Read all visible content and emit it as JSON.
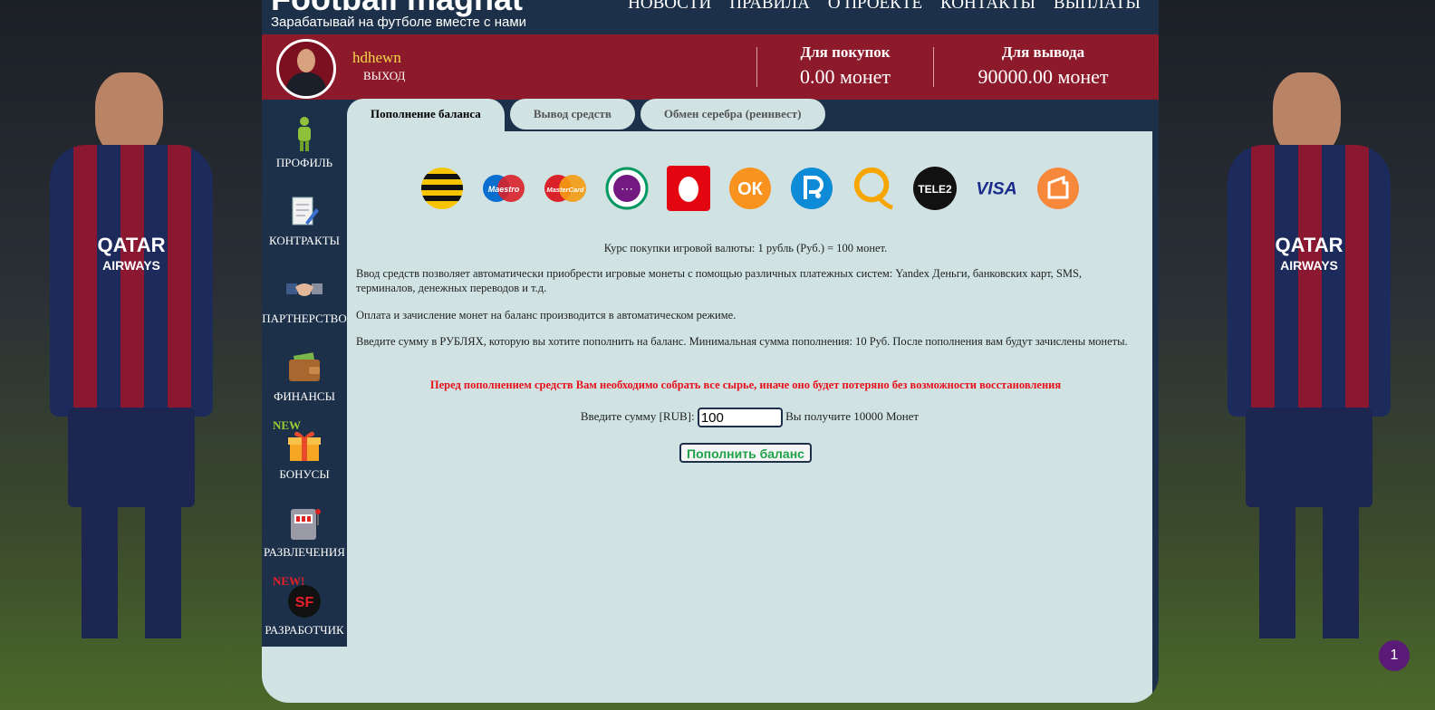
{
  "header": {
    "logo": "Football magnat",
    "tagline": "Зарабатывай на футболе вместе с нами",
    "nav": [
      "НОВОСТИ",
      "ПРАВИЛА",
      "О ПРОЕКТЕ",
      "КОНТАКТЫ",
      "ВЫПЛАТЫ"
    ]
  },
  "user": {
    "name": "hdhewn",
    "logout": "ВЫХОД"
  },
  "balances": {
    "buy": {
      "title": "Для покупок",
      "value": "0.00 монет"
    },
    "withdraw": {
      "title": "Для вывода",
      "value": "90000.00 монет"
    }
  },
  "sidebar": {
    "items": [
      {
        "label": "ПРОФИЛЬ",
        "icon": "person-icon"
      },
      {
        "label": "КОНТРАКТЫ",
        "icon": "document-icon"
      },
      {
        "label": "ПАРТНЕРСТВО",
        "icon": "handshake-icon"
      },
      {
        "label": "ФИНАНСЫ",
        "icon": "wallet-icon"
      },
      {
        "label": "БОНУСЫ",
        "icon": "gift-icon",
        "badge": "NEW"
      },
      {
        "label": "РАЗВЛЕЧЕНИЯ",
        "icon": "slot-machine-icon"
      },
      {
        "label": "РАЗРАБОТЧИК",
        "icon": "developer-logo-icon",
        "badge": "NEW!"
      }
    ]
  },
  "tabs": [
    "Пополнение баланса",
    "Вывод средств",
    "Обмен серебра (реинвест)"
  ],
  "payment_methods": [
    "Beeline",
    "Maestro",
    "MasterCard",
    "Megafon",
    "MTS",
    "Odnoklassniki",
    "Payeer",
    "QIWI",
    "Tele2",
    "VISA",
    "Yandex Money"
  ],
  "payment_labels": {
    "maestro": "Maestro",
    "mastercard": "MasterCard",
    "tele2": "TELE2",
    "visa": "VISA",
    "ok": "ОК",
    "sf": "SF"
  },
  "content": {
    "rate": "Курс покупки игровой валюты: 1 рубль (Руб.) = 100 монет.",
    "p1": "Ввод средств позволяет автоматически приобрести игровые монеты с помощью различных платежных систем: Yandex Деньги, банковских карт, SMS, терминалов, денежных переводов и т.д.",
    "p2": "Оплата и зачисление монет на баланс производится в автоматическом режиме.",
    "p3": "Введите сумму в РУБЛЯХ, которую вы хотите пополнить на баланс. Минимальная сумма пополнения: 10 Руб. После пополнения вам будут зачислены монеты.",
    "warning": "Перед пополнением средств Вам необходимо собрать все сырье, иначе оно будет потеряно без возможности восстановления",
    "amount_label": "Введите сумму [RUB]:",
    "amount_value": "100",
    "receive_text": "Вы получите 10000 Монет",
    "submit_label": "Пополнить баланс"
  },
  "background": {
    "sponsor": "QATAR",
    "sponsor_sub": "AIRWAYS"
  },
  "chat_badge": "1",
  "colors": {
    "header": "#1c3149",
    "userbar": "#8d1a2a",
    "content": "#d0e2e2",
    "warning": "#e8101a",
    "submit_text": "#1ea34a"
  }
}
